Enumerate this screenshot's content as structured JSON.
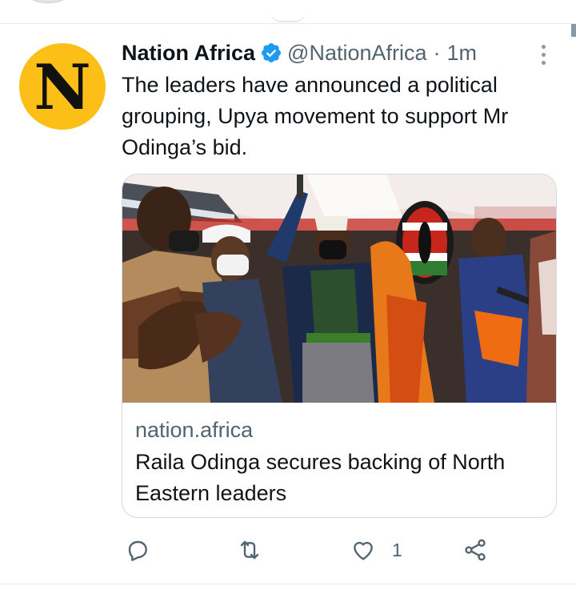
{
  "tweet": {
    "author_name": "Nation Africa",
    "handle": "@NationAfrica",
    "separator": "·",
    "time": "1m",
    "avatar_letter": "N",
    "text": "The leaders have announced a political grouping, Upya movement to support Mr Odinga’s bid.",
    "card": {
      "domain": "nation.africa",
      "title": "Raila Odinga secures backing of North Eastern leaders"
    },
    "actions": {
      "like_count": "1"
    }
  },
  "icons": {
    "verified": "verified-badge-icon",
    "more": "more-options-icon",
    "reply": "reply-icon",
    "retweet": "retweet-icon",
    "like": "like-icon",
    "share": "share-icon"
  },
  "colors": {
    "avatar_bg": "#fcbf17",
    "verified_blue": "#1d9bf0",
    "secondary_text": "#536471",
    "action_icon": "#536471"
  }
}
